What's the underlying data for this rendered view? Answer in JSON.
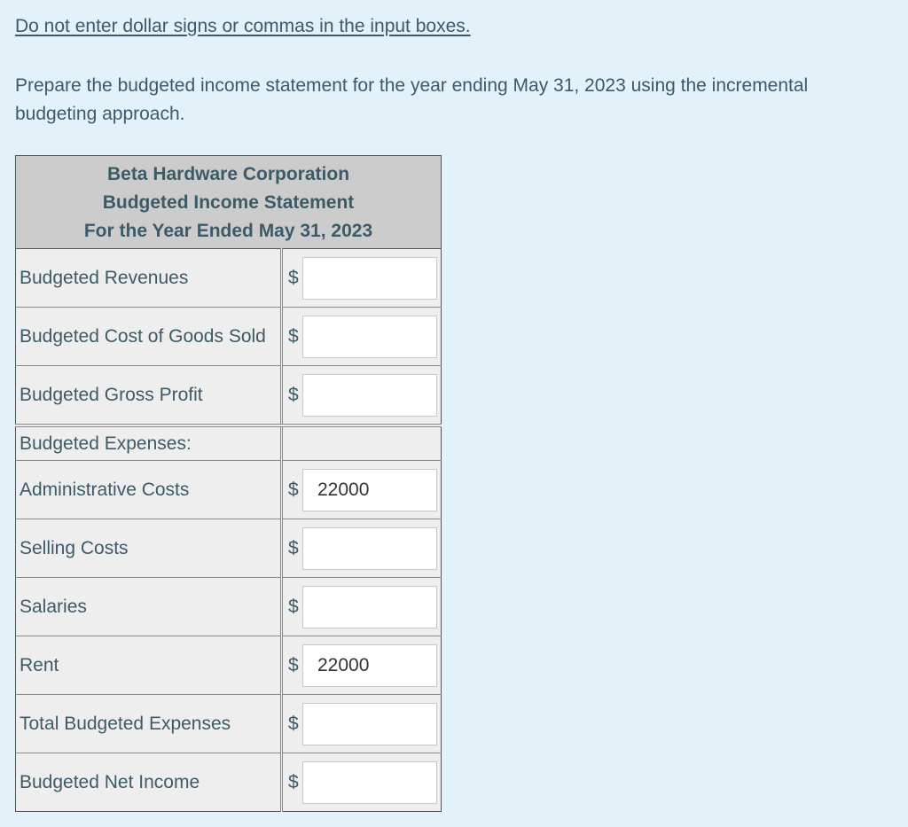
{
  "instruction": "Do not enter dollar signs or commas in the input boxes.",
  "prompt": "Prepare the budgeted income statement for the year ending May 31, 2023 using the incremental budgeting approach.",
  "statement": {
    "header": [
      "Beta Hardware Corporation",
      "Budgeted Income Statement",
      "For the Year Ended May 31, 2023"
    ],
    "currency_symbol": "$",
    "rows": [
      {
        "label": "Budgeted Revenues",
        "value": ""
      },
      {
        "label": "Budgeted Cost of Goods Sold",
        "value": ""
      },
      {
        "label": "Budgeted Gross Profit",
        "value": ""
      },
      {
        "label": "Budgeted Expenses:"
      },
      {
        "label": "Administrative Costs",
        "value": "22000"
      },
      {
        "label": "Selling Costs",
        "value": ""
      },
      {
        "label": "Salaries",
        "value": ""
      },
      {
        "label": "Rent",
        "value": "22000"
      },
      {
        "label": "Total Budgeted Expenses",
        "value": ""
      },
      {
        "label": "Budgeted Net Income",
        "value": ""
      }
    ]
  }
}
